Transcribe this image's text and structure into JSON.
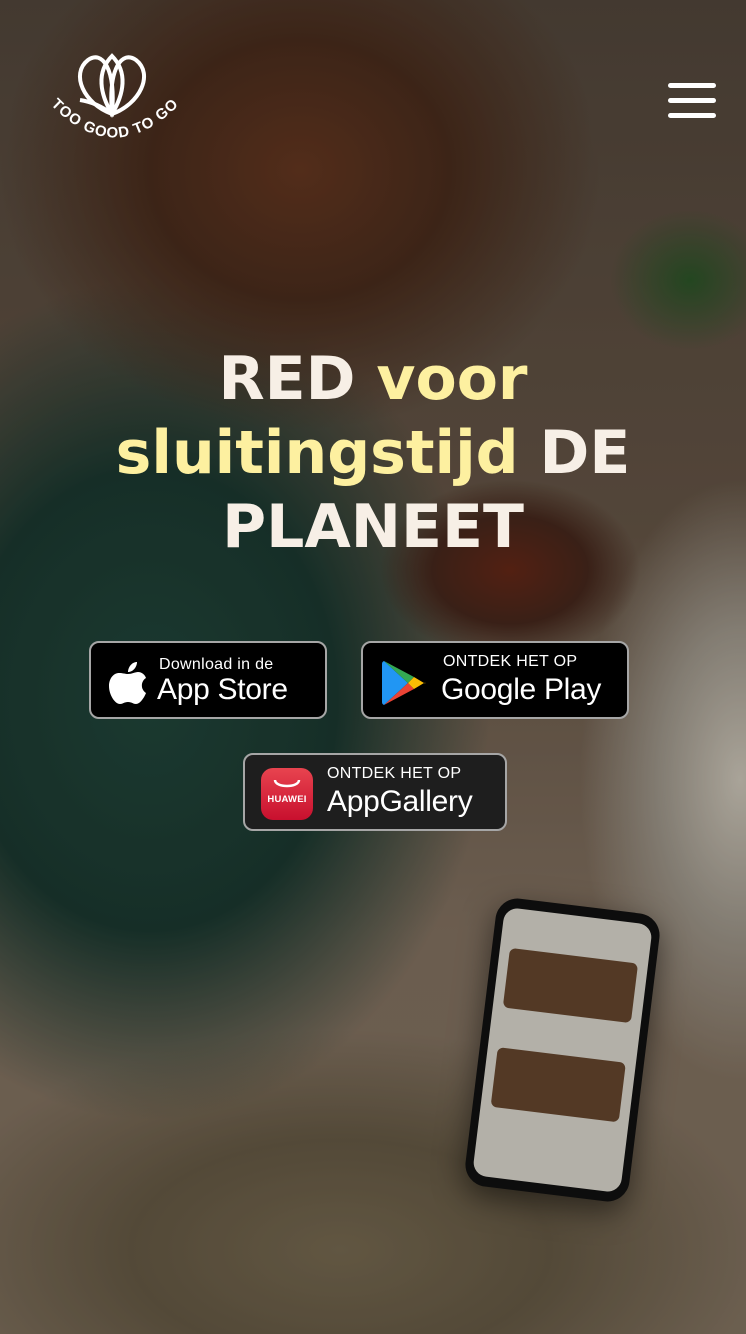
{
  "brand": {
    "logo_text": "TOO GOOD TO GO"
  },
  "header": {
    "menu_icon": "hamburger-menu-icon"
  },
  "hero": {
    "word1": "RED",
    "word2": "voor",
    "word3": "sluitingstijd",
    "word4": "DE",
    "word5": "PLANEET",
    "text_color": "#f7efe6",
    "accent_color": "#fdf0a0"
  },
  "stores": {
    "app_store": {
      "small": "Download in de",
      "big": "App Store",
      "icon": "apple-icon"
    },
    "google_play": {
      "small": "ONTDEK HET OP",
      "big": "Google Play",
      "icon": "google-play-icon"
    },
    "app_gallery": {
      "small": "ONTDEK HET OP",
      "big": "AppGallery",
      "brand": "HUAWEI",
      "icon": "huawei-appgallery-icon"
    }
  }
}
